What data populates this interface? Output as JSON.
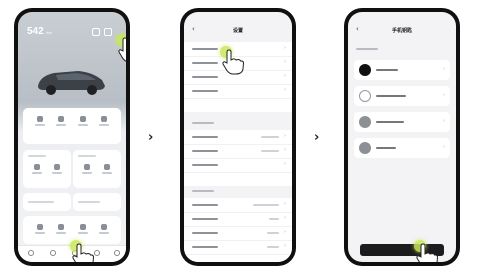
{
  "phone1": {
    "range": "542",
    "range_unit": "km"
  },
  "phone2": {
    "title": "设置"
  },
  "phone3": {
    "title": "手机钥匙",
    "arrow_glyph": "›"
  },
  "step_arrow": "›",
  "colors": {
    "accent": "#c9e85a",
    "bezel": "#101010",
    "button": "#1c1c1c"
  },
  "icons": [
    "hand-pointer-icon",
    "back-arrow-icon",
    "chevron-right-icon",
    "car-image",
    "key-icon"
  ]
}
